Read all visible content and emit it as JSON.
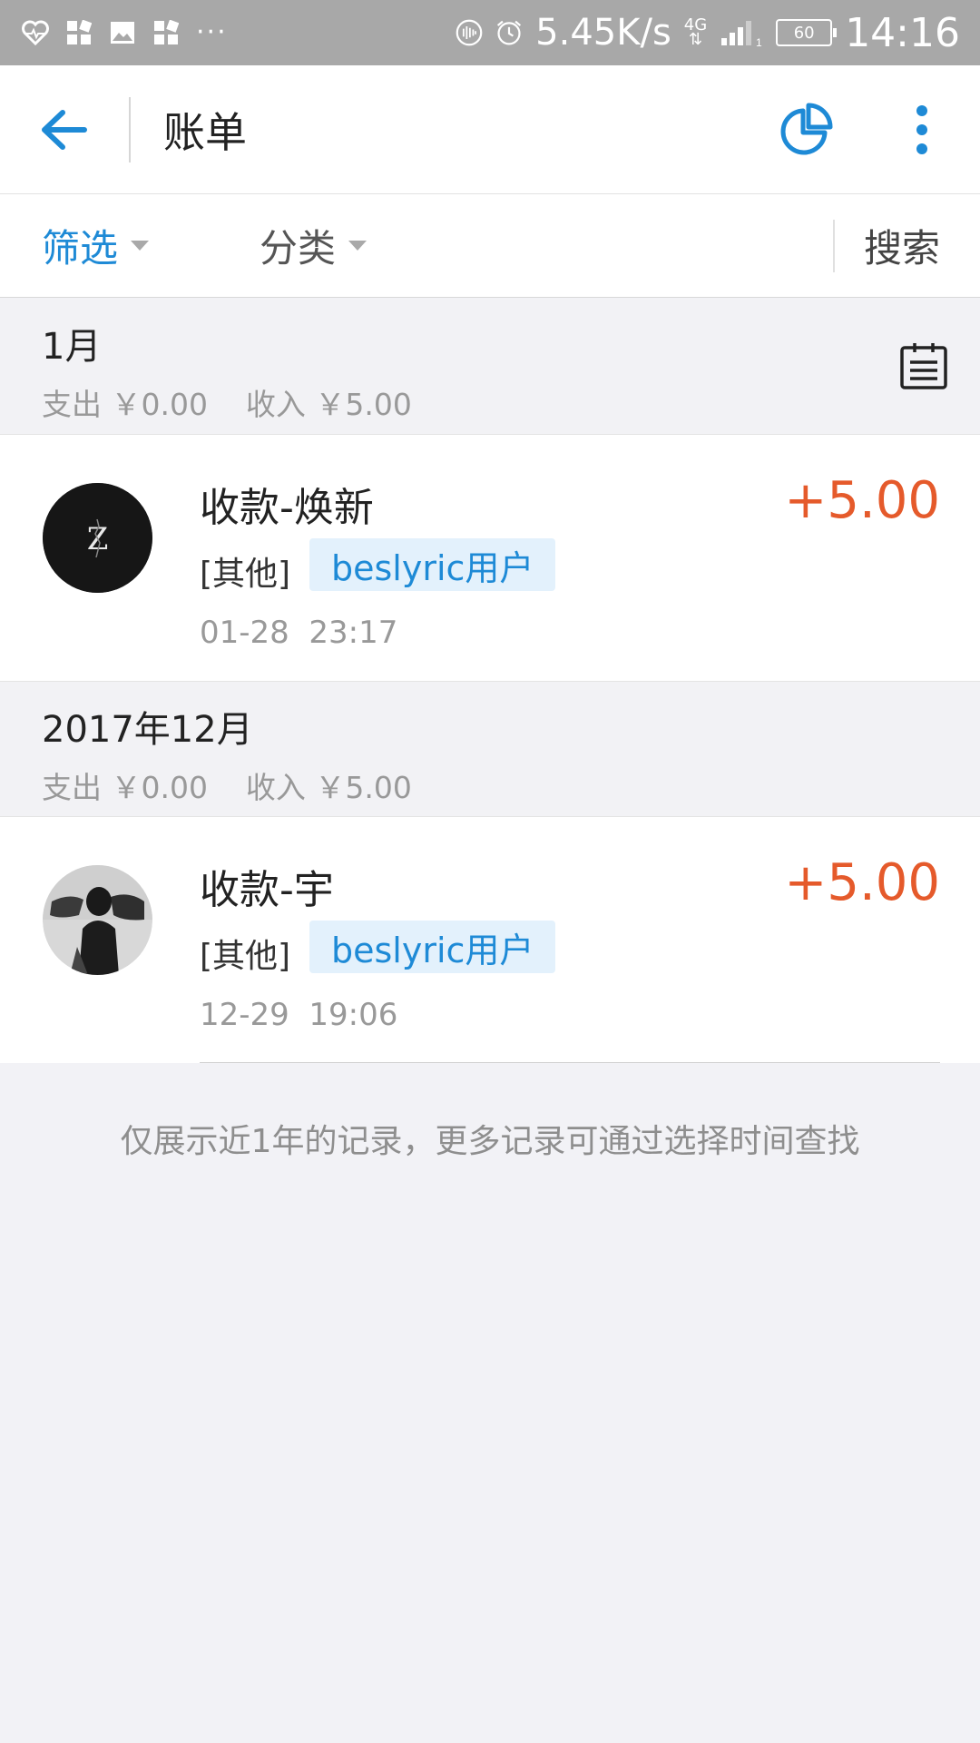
{
  "status_bar": {
    "speed": "5.45K/s",
    "network": "4G",
    "signal_sub": "1",
    "battery": "60",
    "time": "14:16",
    "left_icons": [
      "heart-rate-icon",
      "apps-icon",
      "image-icon",
      "apps-icon",
      "more-dots-icon"
    ],
    "dots": "···"
  },
  "header": {
    "title": "账单",
    "accent_color": "#1e8ad6"
  },
  "filter_bar": {
    "screen_label": "筛选",
    "category_label": "分类",
    "search_label": "搜索"
  },
  "months": [
    {
      "title": "1月",
      "summary": "支出 ￥0.00    收入 ￥5.00"
    },
    {
      "title": "2017年12月",
      "summary": "支出 ￥0.00    收入 ￥5.00"
    }
  ],
  "transactions": [
    {
      "title": "收款-焕新",
      "category": "[其他]",
      "tag": "beslyric用户",
      "time": "01-28  23:17",
      "amount": "+5.00",
      "avatar_letter": "Z"
    },
    {
      "title": "收款-宇",
      "category": "[其他]",
      "tag": "beslyric用户",
      "time": "12-29  19:06",
      "amount": "+5.00"
    }
  ],
  "footer_note": "仅展示近1年的记录，更多记录可通过选择时间查找",
  "colors": {
    "amount": "#e55a2b",
    "tag_bg": "#e3f1fc",
    "tag_text": "#1e8ad6",
    "status_bar": "#a8a8a8"
  }
}
